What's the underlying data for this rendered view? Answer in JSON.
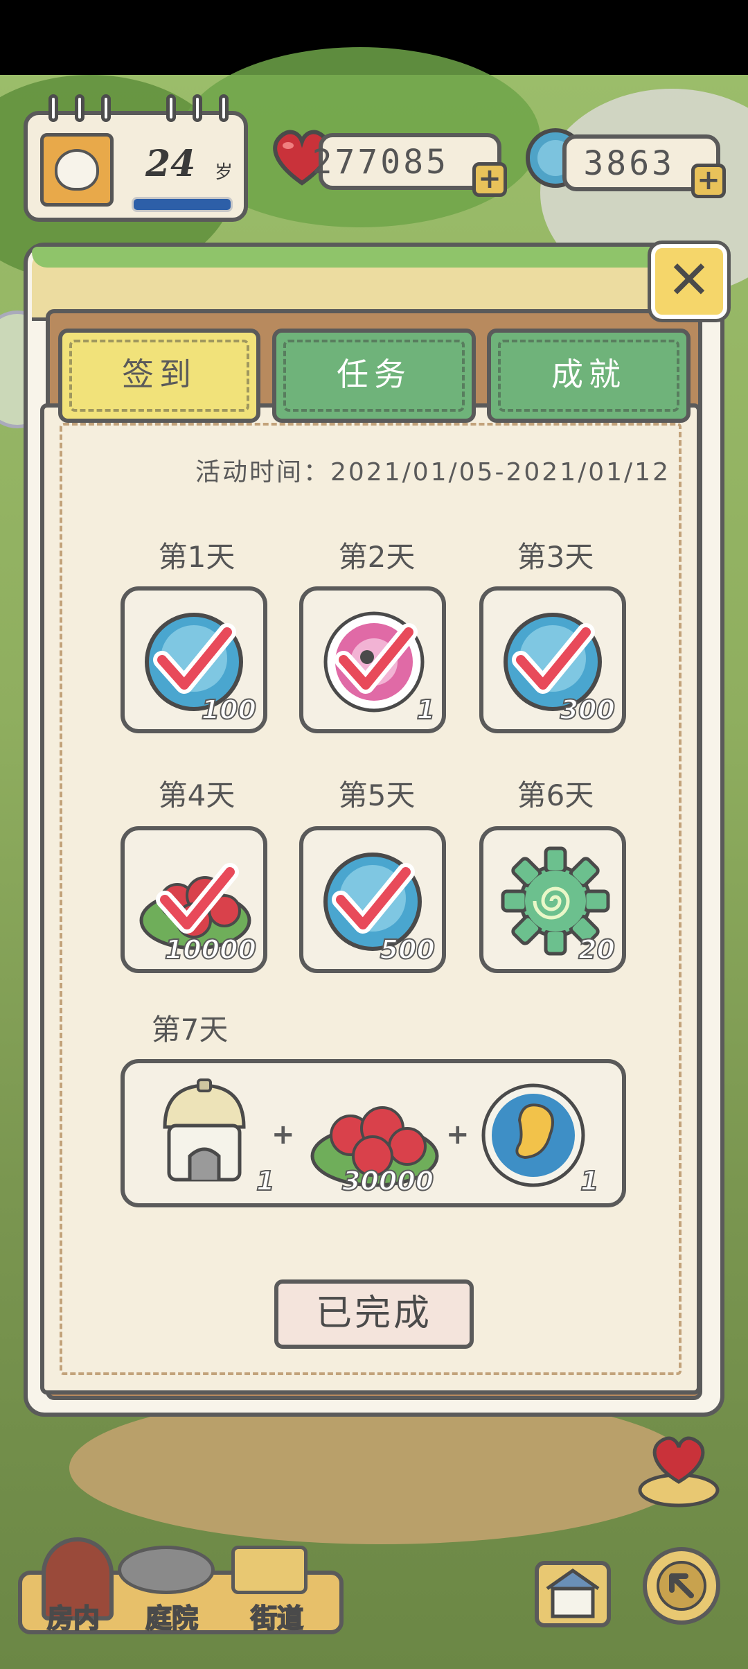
{
  "header": {
    "age": "24",
    "age_unit": "岁",
    "hearts": "277085",
    "caps": "3863"
  },
  "tabs": [
    {
      "label": "签到",
      "active": true
    },
    {
      "label": "任务",
      "active": false
    },
    {
      "label": "成就",
      "active": false
    }
  ],
  "event_time": "活动时间：2021/01/05-2021/01/12",
  "days": [
    {
      "label": "第1天",
      "item": "blue-cap",
      "qty": "100",
      "claimed": true
    },
    {
      "label": "第2天",
      "item": "pink-ticket",
      "qty": "1",
      "claimed": true
    },
    {
      "label": "第3天",
      "item": "blue-cap",
      "qty": "300",
      "claimed": true
    },
    {
      "label": "第4天",
      "item": "clover-hearts",
      "qty": "10000",
      "claimed": true
    },
    {
      "label": "第5天",
      "item": "blue-cap",
      "qty": "500",
      "claimed": true
    },
    {
      "label": "第6天",
      "item": "green-gear",
      "qty": "20",
      "claimed": false
    }
  ],
  "day7": {
    "label": "第7天",
    "rewards": [
      {
        "item": "mushroom-house",
        "qty": "1"
      },
      {
        "item": "clover-hearts",
        "qty": "30000"
      },
      {
        "item": "frog-egg",
        "qty": "1"
      }
    ],
    "plus": "+"
  },
  "done_button": "已完成",
  "close_symbol": "✕",
  "plus_symbol": "+",
  "bottom_nav": [
    {
      "label": "房内"
    },
    {
      "label": "庭院"
    },
    {
      "label": "街道"
    }
  ],
  "colors": {
    "active_tab": "#f1e27a",
    "inactive_tab": "#6fb37a",
    "check": "#e84a5a"
  }
}
